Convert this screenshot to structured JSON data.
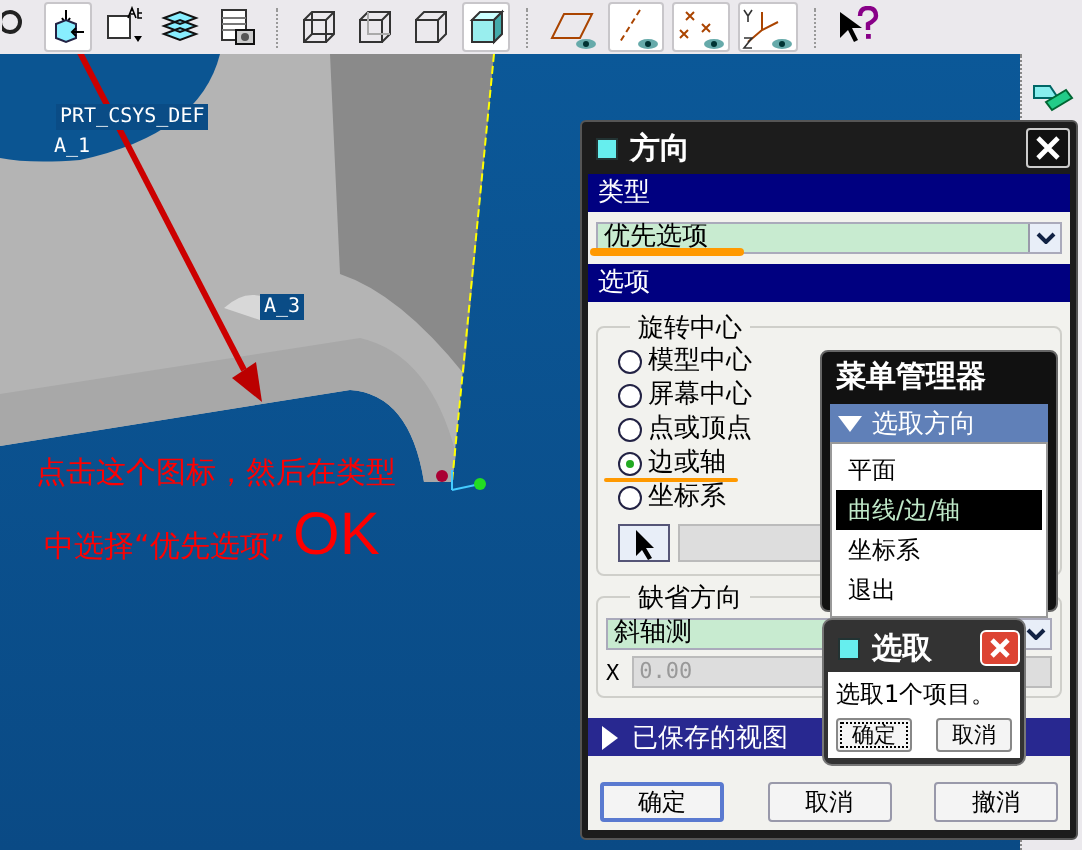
{
  "toolbar": {
    "tools": [
      {
        "kind": "zoom",
        "pressed": false
      },
      {
        "kind": "orient",
        "pressed": true
      },
      {
        "kind": "view-manager",
        "pressed": false
      },
      {
        "kind": "layers",
        "pressed": false
      },
      {
        "kind": "snapshot",
        "pressed": false
      },
      {
        "kind": "wireframe",
        "pressed": false
      },
      {
        "kind": "hidden-line",
        "pressed": false
      },
      {
        "kind": "no-hidden",
        "pressed": false
      },
      {
        "kind": "shaded",
        "pressed": true
      },
      {
        "kind": "planes",
        "pressed": false
      },
      {
        "kind": "axes",
        "pressed": true
      },
      {
        "kind": "points",
        "pressed": true
      },
      {
        "kind": "csys",
        "pressed": true
      },
      {
        "kind": "help",
        "pressed": false
      }
    ]
  },
  "viewport": {
    "labels": [
      {
        "kind": "csys",
        "text": "PRT_CSYS_DEF"
      },
      {
        "kind": "axis1",
        "text": "A_1"
      },
      {
        "kind": "axis3",
        "text": "A_3"
      }
    ],
    "annotation": {
      "line_1": "点击这个图标，然后在类型",
      "line_2": "中选择“优先选项”",
      "ok": "OK"
    }
  },
  "dialog": {
    "title": "方向",
    "type_section": {
      "header": "类型",
      "value": "优先选项"
    },
    "options_section": {
      "header": "选项",
      "rotation_center": {
        "title": "旋转中心",
        "options": [
          {
            "label": "模型中心",
            "selected": false
          },
          {
            "label": "屏幕中心",
            "selected": false
          },
          {
            "label": "点或顶点",
            "selected": false
          },
          {
            "label": "边或轴",
            "selected": true
          },
          {
            "label": "坐标系",
            "selected": false
          }
        ]
      },
      "default_orientation": {
        "title": "缺省方向",
        "value": "斜轴测",
        "x_label": "X",
        "x_value": "0.00",
        "x_disabled": true
      }
    },
    "saved_views": {
      "label": "已保存的视图",
      "expanded": false
    },
    "buttons": [
      {
        "label": "确定",
        "default": true
      },
      {
        "label": "取消",
        "default": false
      },
      {
        "label": "撤消",
        "default": false
      }
    ]
  },
  "menu_manager": {
    "title": "菜单管理器",
    "header": {
      "label": "选取方向",
      "expanded": true
    },
    "items": [
      {
        "label": "平面",
        "selected": false
      },
      {
        "label": "曲线/边/轴",
        "selected": true
      },
      {
        "label": "坐标系",
        "selected": false
      },
      {
        "label": "退出",
        "selected": false
      }
    ]
  },
  "select_popup": {
    "title": "选取",
    "message": "选取1个项目。",
    "buttons": [
      {
        "label": "确定",
        "focused": true
      },
      {
        "label": "取消",
        "focused": false
      }
    ]
  }
}
